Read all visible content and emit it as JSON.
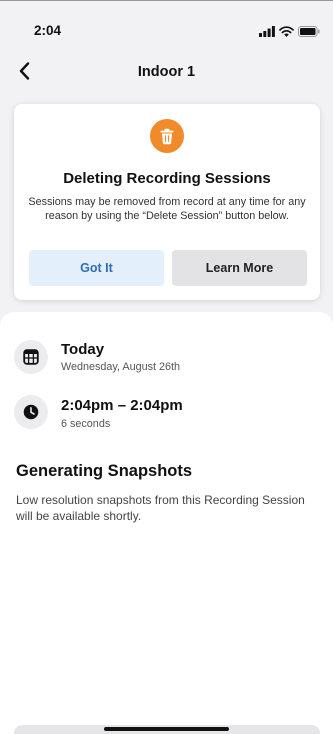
{
  "status_bar": {
    "time": "2:04"
  },
  "nav": {
    "title": "Indoor 1"
  },
  "info_card": {
    "title": "Deleting Recording Sessions",
    "text": "Sessions may be removed from record at any time for any reason by using the “Delete Session” button below.",
    "got_it_label": "Got It",
    "learn_more_label": "Learn More"
  },
  "date_row": {
    "title": "Today",
    "subtitle": "Wednesday, August 26th"
  },
  "time_row": {
    "title": "2:04pm – 2:04pm",
    "subtitle": "6 seconds"
  },
  "snapshots": {
    "title": "Generating Snapshots",
    "body": "Low resolution snapshots from this Recording Session will be available shortly."
  },
  "colors": {
    "accent_orange": "#f08a2a",
    "got_it_bg": "#e3f0fb",
    "got_it_text": "#2f6db3",
    "learn_more_bg": "#e3e3e6"
  },
  "icons": [
    "signal-icon",
    "wifi-icon",
    "battery-icon",
    "back-chevron-icon",
    "trash-icon",
    "calendar-icon",
    "clock-icon"
  ]
}
